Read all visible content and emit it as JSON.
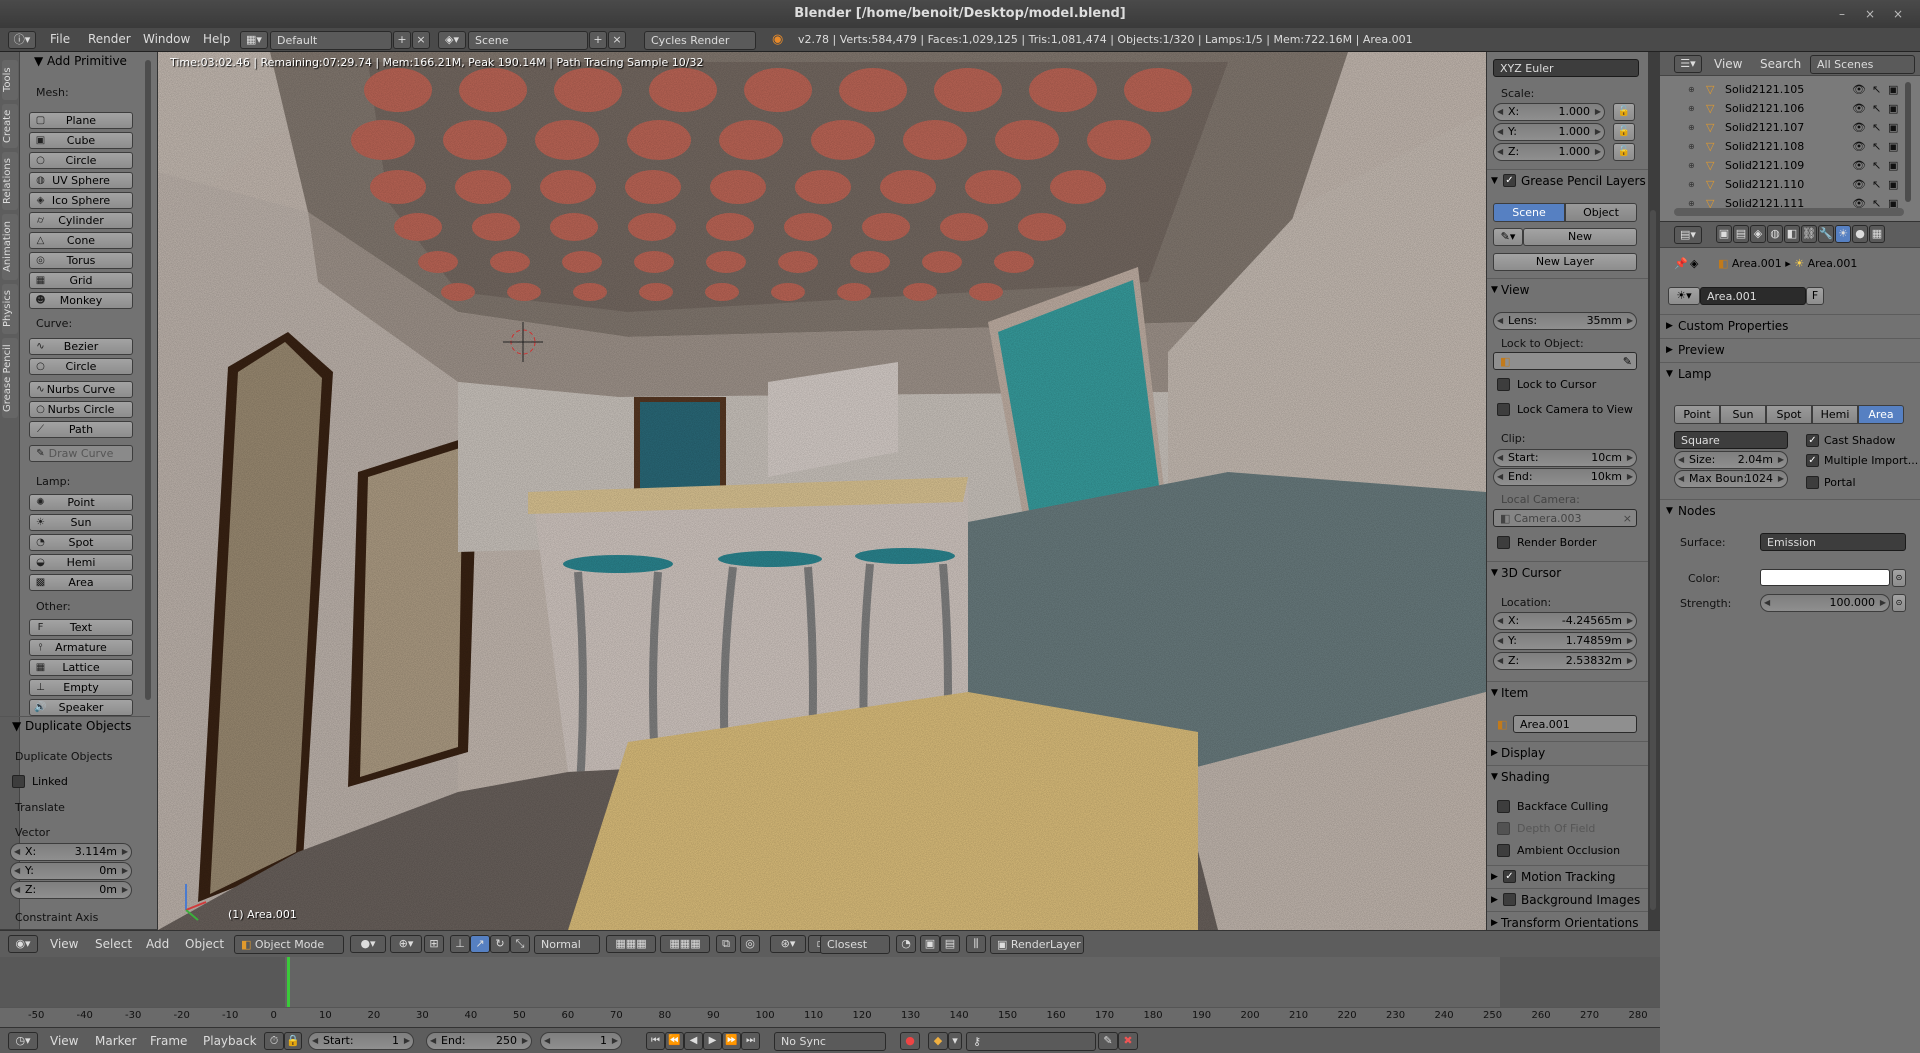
{
  "window": {
    "title": "Blender [/home/benoit/Desktop/model.blend]",
    "buttons": [
      "–",
      "×",
      "×"
    ]
  },
  "infobar": {
    "menus": [
      "File",
      "Render",
      "Window",
      "Help"
    ],
    "layout": "Default",
    "scene": "Scene",
    "engine": "Cycles Render",
    "stats": "v2.78 | Verts:584,479 | Faces:1,029,125 | Tris:1,081,474 | Objects:1/320 | Lamps:1/5 | Mem:722.16M | Area.001"
  },
  "tool_tabs": [
    "Tools",
    "Create",
    "Relations",
    "Animation",
    "Physics",
    "Grease Pencil"
  ],
  "tools": {
    "title": "Add Primitive",
    "mesh_label": "Mesh:",
    "mesh": [
      "Plane",
      "Cube",
      "Circle",
      "UV Sphere",
      "Ico Sphere",
      "Cylinder",
      "Cone",
      "Torus"
    ],
    "mesh2": [
      "Grid",
      "Monkey"
    ],
    "curve_label": "Curve:",
    "curve": [
      "Bezier",
      "Circle"
    ],
    "curve2": [
      "Nurbs Curve",
      "Nurbs Circle",
      "Path"
    ],
    "draw_curve": "Draw Curve",
    "lamp_label": "Lamp:",
    "lamp": [
      "Point",
      "Sun",
      "Spot",
      "Hemi",
      "Area"
    ],
    "other_label": "Other:",
    "other": [
      "Text",
      "Armature",
      "Lattice",
      "Empty",
      "Speaker"
    ]
  },
  "operator": {
    "title": "Duplicate Objects",
    "name": "Duplicate Objects",
    "linked": "Linked",
    "translate": "Translate",
    "vector": "Vector",
    "x_label": "X:",
    "x": "3.114m",
    "y_label": "Y:",
    "y": "0m",
    "z_label": "Z:",
    "z": "0m",
    "constraint": "Constraint Axis"
  },
  "viewport": {
    "info": "Time:03:02.46 | Remaining:07:29.74 | Mem:166.21M, Peak 190.14M | Path Tracing Sample 10/32",
    "object": "(1) Area.001"
  },
  "npanel": {
    "rotation_mode": "XYZ Euler",
    "scale_label": "Scale:",
    "scale": [
      [
        "X:",
        "1.000"
      ],
      [
        "Y:",
        "1.000"
      ],
      [
        "Z:",
        "1.000"
      ]
    ],
    "gp_title": "Grease Pencil Layers",
    "gp_scene": "Scene",
    "gp_object": "Object",
    "gp_new": "New",
    "gp_new_layer": "New Layer",
    "view_title": "View",
    "lens_label": "Lens:",
    "lens": "35mm",
    "lock_obj": "Lock to Object:",
    "lock_cursor": "Lock to Cursor",
    "lock_camera": "Lock Camera to View",
    "clip": "Clip:",
    "clip_start_label": "Start:",
    "clip_start": "10cm",
    "clip_end_label": "End:",
    "clip_end": "10km",
    "local_camera": "Local Camera:",
    "camera": "Camera.003",
    "render_border": "Render Border",
    "cursor_title": "3D Cursor",
    "location": "Location:",
    "cursor": [
      [
        "X:",
        "-4.24565m"
      ],
      [
        "Y:",
        "1.74859m"
      ],
      [
        "Z:",
        "2.53832m"
      ]
    ],
    "item_title": "Item",
    "item_name": "Area.001",
    "display_title": "Display",
    "shading_title": "Shading",
    "backface": "Backface Culling",
    "dof": "Depth Of Field",
    "ao": "Ambient Occlusion",
    "motion": "Motion Tracking",
    "bg_images": "Background Images",
    "transform_orient": "Transform Orientations"
  },
  "outliner": {
    "menus": [
      "View",
      "Search"
    ],
    "scope": "All Scenes",
    "rows": [
      "Solid2121.105",
      "Solid2121.106",
      "Solid2121.107",
      "Solid2121.108",
      "Solid2121.109",
      "Solid2121.110",
      "Solid2121.111"
    ]
  },
  "properties": {
    "breadcrumb1": "Area.001",
    "breadcrumb2": "Area.001",
    "datablock": "Area.001",
    "fake": "F",
    "custom": "Custom Properties",
    "preview": "Preview",
    "lamp": "Lamp",
    "lamp_types": [
      "Point",
      "Sun",
      "Spot",
      "Hemi",
      "Area"
    ],
    "shape": "Square",
    "size_label": "Size:",
    "size": "2.04m",
    "maxb_label": "Max Boun:",
    "maxb": "1024",
    "cast_shadow": "Cast Shadow",
    "mis": "Multiple Import...",
    "portal": "Portal",
    "nodes": "Nodes",
    "surface_label": "Surface:",
    "surface": "Emission",
    "color_label": "Color:",
    "strength_label": "Strength:",
    "strength": "100.000"
  },
  "vpheader": {
    "menus": [
      "View",
      "Select",
      "Add",
      "Object"
    ],
    "mode": "Object Mode",
    "pivot": "Normal",
    "snap": "Closest",
    "layer": "RenderLayer"
  },
  "timeline": {
    "ticks": [
      "-50",
      "-40",
      "-30",
      "-20",
      "-10",
      "0",
      "10",
      "20",
      "30",
      "40",
      "50",
      "60",
      "70",
      "80",
      "90",
      "100",
      "110",
      "120",
      "130",
      "140",
      "150",
      "160",
      "170",
      "180",
      "190",
      "200",
      "210",
      "220",
      "230",
      "240",
      "250",
      "260",
      "270",
      "280"
    ],
    "menus": [
      "View",
      "Marker",
      "Frame",
      "Playback"
    ],
    "start_label": "Start:",
    "start": "1",
    "end_label": "End:",
    "end": "250",
    "current": "1",
    "sync": "No Sync"
  },
  "colors": {
    "accent": "#5680c2",
    "panel": "#727272",
    "frame_marker": "#3ac93a"
  }
}
